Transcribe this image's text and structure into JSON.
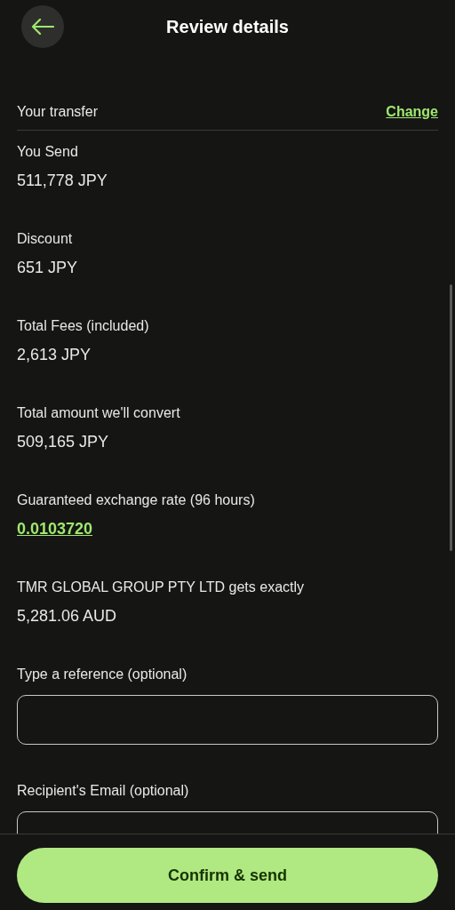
{
  "header": {
    "title": "Review details"
  },
  "section": {
    "title": "Your transfer",
    "action": "Change"
  },
  "details": [
    {
      "kind": "amount",
      "label": "You Send",
      "value": "511,778 JPY"
    },
    {
      "kind": "amount",
      "label": "Discount",
      "value": "651 JPY"
    },
    {
      "kind": "amount",
      "label": "Total Fees (included)",
      "value": "2,613 JPY"
    },
    {
      "kind": "amount",
      "label": "Total amount we'll convert",
      "value": "509,165 JPY"
    },
    {
      "kind": "link",
      "label": "Guaranteed exchange rate (96 hours)",
      "value": "0.0103720"
    },
    {
      "kind": "amount",
      "label": "TMR GLOBAL GROUP PTY LTD gets exactly",
      "value": "5,281.06 AUD"
    }
  ],
  "fields": [
    {
      "label": "Type a reference (optional)"
    },
    {
      "label": "Recipient's Email (optional)"
    }
  ],
  "button": "Confirm & send"
}
